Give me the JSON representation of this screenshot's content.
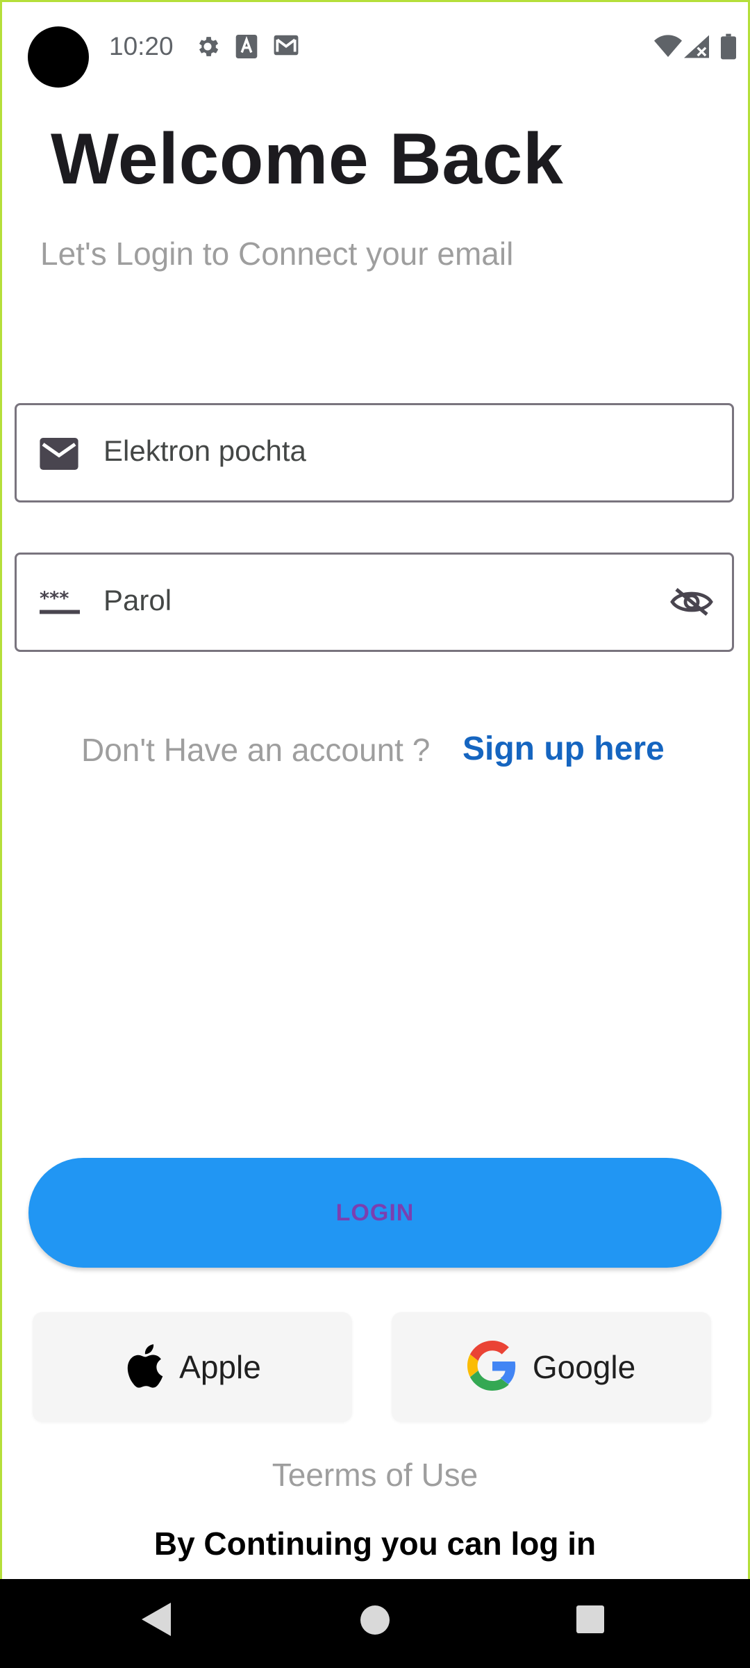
{
  "status_bar": {
    "time": "10:20",
    "left_icons": [
      "settings-icon",
      "font-a-icon",
      "gmail-icon"
    ],
    "right_icons": [
      "wifi-icon",
      "signal-icon",
      "battery-icon"
    ]
  },
  "header": {
    "title": "Welcome Back",
    "subtitle": "Let's Login to Connect your email"
  },
  "form": {
    "email": {
      "label": "Elektron pochta",
      "icon": "mail-icon"
    },
    "password": {
      "label": "Parol",
      "icon": "password-icon",
      "toggle_icon": "eye-off-icon"
    }
  },
  "signup": {
    "question": "Don't Have an account ?",
    "link": "Sign up here"
  },
  "login_button": "LOGIN",
  "social": {
    "apple": "Apple",
    "google": "Google"
  },
  "footer": {
    "terms": "Teerms of Use",
    "continue_text": "By Continuing you can log in"
  },
  "colors": {
    "primary": "#2196f3",
    "link": "#1565c0",
    "login_text": "#7b3fb0",
    "frame": "#b5df3a"
  }
}
